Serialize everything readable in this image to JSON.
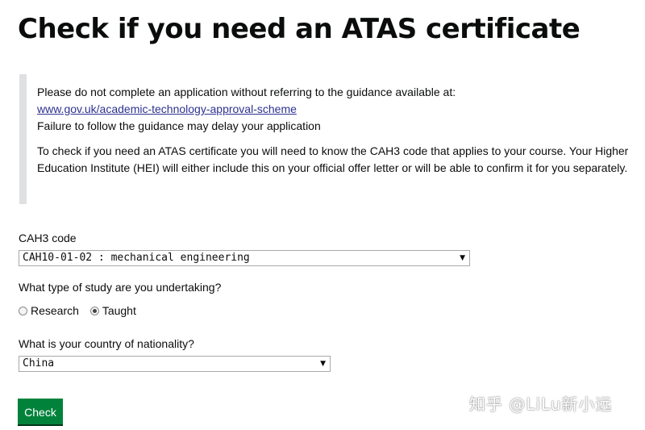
{
  "page": {
    "title": "Check if you need an ATAS certificate"
  },
  "guidance": {
    "line1": "Please do not complete an application without referring to the guidance available at:",
    "link": "www.gov.uk/academic-technology-approval-scheme",
    "line3": "Failure to follow the guidance may delay your application",
    "para2": "To check if you need an ATAS certificate you will need to know the CAH3 code that applies to your course. Your Higher Education Institute (HEI) will either include this on your official offer letter or will be able to confirm it for you separately."
  },
  "form": {
    "cah3_label": "CAH3 code",
    "cah3_value": "CAH10-01-02 : mechanical engineering",
    "study_label": "What type of study are you undertaking?",
    "study_options": [
      {
        "label": "Research",
        "checked": false
      },
      {
        "label": "Taught",
        "checked": true
      }
    ],
    "nationality_label": "What is your country of nationality?",
    "nationality_value": "China",
    "submit_label": "Check"
  },
  "watermark": "知乎 @LiLu新小远",
  "colors": {
    "button": "#00823b",
    "link": "#2e3191",
    "inset_border": "#dee0e2"
  }
}
